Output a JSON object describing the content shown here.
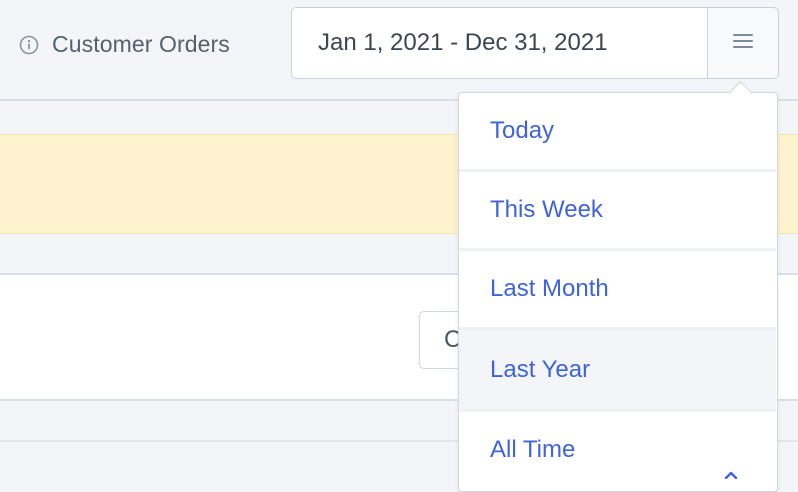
{
  "header": {
    "title": "Customer Orders",
    "date_range_value": "Jan 1, 2021 - Dec 31, 2021"
  },
  "panel": {
    "button_label": "C"
  },
  "dropdown": {
    "items": [
      {
        "label": "Today"
      },
      {
        "label": "This Week"
      },
      {
        "label": "Last Month"
      },
      {
        "label": "Last Year",
        "active": true
      },
      {
        "label": "All Time"
      }
    ]
  },
  "colors": {
    "link_blue": "#3f63da",
    "alert_bg": "#fef2cf",
    "page_bg": "#f3f5f8"
  },
  "icons": {
    "title_icon": "info-icon",
    "menu_icon": "hamburger-icon"
  }
}
